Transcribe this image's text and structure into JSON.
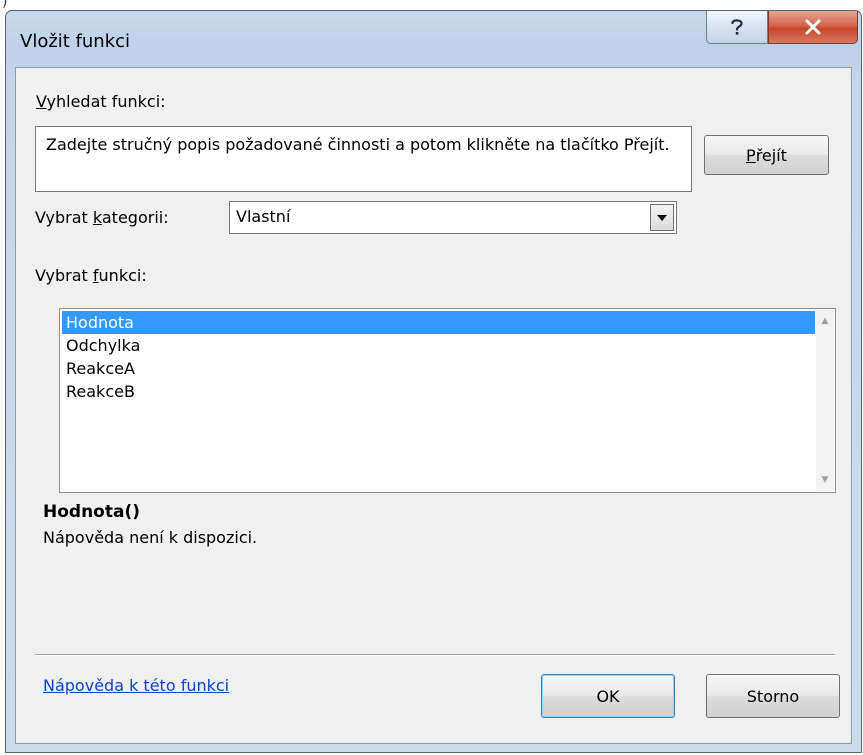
{
  "window": {
    "title": "Vložit funkci",
    "help_icon": "question-mark-icon",
    "close_icon": "close-x-icon"
  },
  "search": {
    "label_underline": "V",
    "label_rest": "yhledat funkci:",
    "text": "Zadejte stručný popis požadované činnosti a potom klikněte na tlačítko Přejít.",
    "go_underline": "P",
    "go_rest": "řejít"
  },
  "category": {
    "label_before": "Vybrat ",
    "label_underline": "k",
    "label_after": "ategorii:",
    "value": "Vlastní"
  },
  "functions": {
    "label_before": "Vybrat ",
    "label_underline": "f",
    "label_after": "unkci:",
    "items": [
      "Hodnota",
      "Odchylka",
      "ReakceA",
      "ReakceB"
    ],
    "selected": 0
  },
  "details": {
    "signature": "Hodnota()",
    "description": "Nápověda není k dispozici."
  },
  "footer": {
    "help_link": "Nápověda k této funkci",
    "ok_label": "OK",
    "cancel_label": "Storno"
  },
  "colors": {
    "selection": "#3399ff",
    "link": "#0645c8",
    "close_button": "#c4452b"
  }
}
